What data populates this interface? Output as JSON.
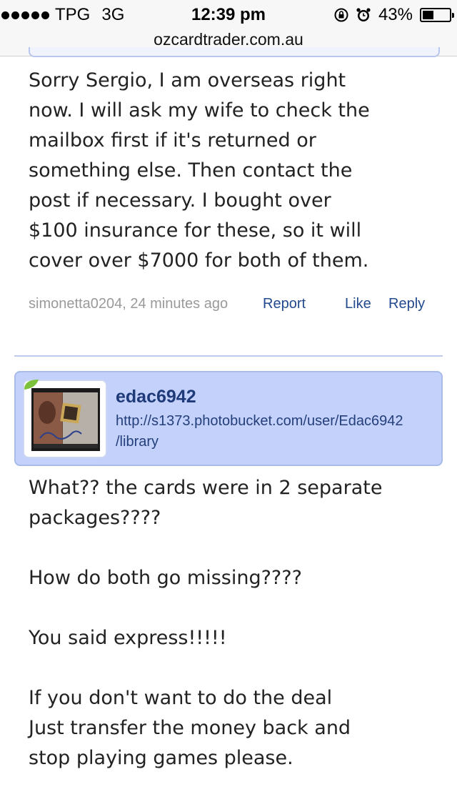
{
  "status_bar": {
    "carrier": "TPG",
    "network": "3G",
    "time": "12:39 pm",
    "battery": "43%",
    "battery_level": 0.43
  },
  "browser": {
    "url": "ozcardtrader.com.au"
  },
  "comment1": {
    "body": "Sorry Sergio, I am overseas right\nnow. I will ask my wife to check the\nmailbox first if it's returned or\nsomething else. Then contact the\npost if necessary. I bought over\n$100 insurance for these, so it will\ncover over $7000 for both of them.",
    "author_time": "simonetta0204, 24 minutes ago",
    "report_label": "Report",
    "like_label": "Like",
    "reply_label": "Reply"
  },
  "comment2": {
    "username": "edac6942",
    "signature_link": "http://s1373.photobucket.com/user/Edac6942\n/library",
    "body": "What?? the cards were in 2 separate\npackages????\n\nHow do both go missing????\n\nYou said express!!!!!\n\nIf you don't want to do the deal\nJust transfer the money back and\nstop playing games please."
  },
  "colors": {
    "link": "#23498e",
    "header_bg": "#c3d1fb",
    "meta_gray": "#9a9a9a"
  },
  "icons": [
    "signal-dots-icon",
    "rotation-lock-icon",
    "alarm-icon",
    "battery-icon",
    "card-avatar-icon",
    "leaf-badge-icon"
  ]
}
